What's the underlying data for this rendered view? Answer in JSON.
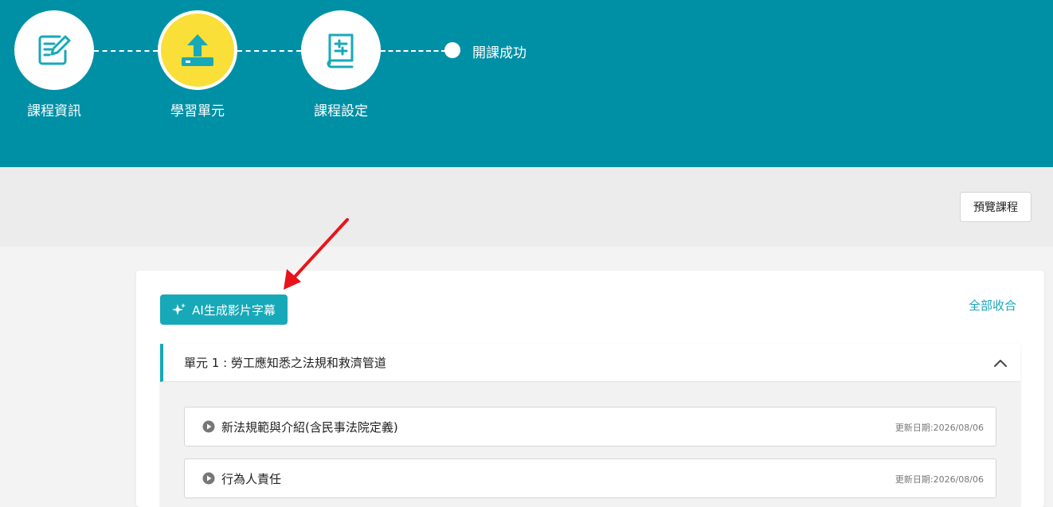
{
  "steps": [
    {
      "label": "課程資訊",
      "icon": "edit-form-icon"
    },
    {
      "label": "學習單元",
      "icon": "upload-icon"
    },
    {
      "label": "課程設定",
      "icon": "book-settings-icon"
    }
  ],
  "final_step": {
    "label": "開課成功"
  },
  "toolbar": {
    "preview_label": "預覽課程"
  },
  "actions": {
    "ai_subtitle_label": "AI生成影片字幕",
    "collapse_all_label": "全部收合"
  },
  "unit": {
    "title": "單元 1 : 勞工應知悉之法規和救濟管道",
    "lessons": [
      {
        "title": "新法規範與介紹(含民事法院定義)",
        "updated": "更新日期:2026/08/06"
      },
      {
        "title": "行為人責任",
        "updated": "更新日期:2026/08/06"
      }
    ]
  },
  "colors": {
    "header": "#0090a6",
    "accent": "#17a9b8",
    "active_step": "#f9df38",
    "annotation_arrow": "#e8141b"
  }
}
